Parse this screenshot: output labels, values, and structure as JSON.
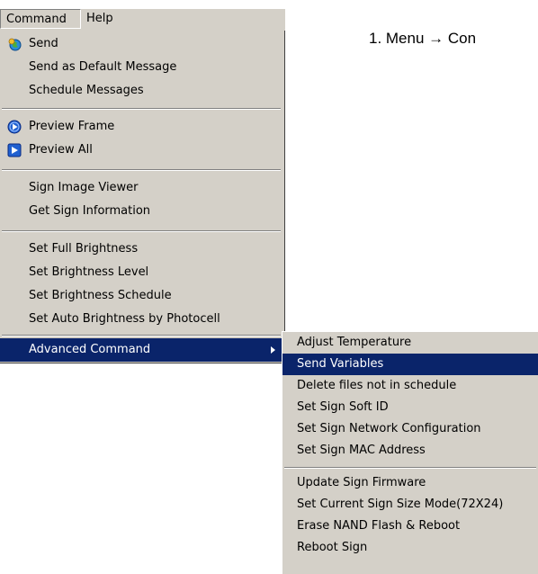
{
  "menubar": {
    "items": [
      {
        "label": "Command"
      },
      {
        "label": "Help"
      }
    ]
  },
  "command_menu": {
    "items": [
      {
        "label": "Send",
        "icon": "send-globe-icon"
      },
      {
        "label": "Send as Default Message"
      },
      {
        "label": "Schedule Messages"
      },
      {
        "label": "Preview Frame",
        "icon": "preview-frame-icon"
      },
      {
        "label": "Preview All",
        "icon": "preview-all-icon"
      },
      {
        "label": "Sign Image Viewer"
      },
      {
        "label": "Get Sign Information"
      },
      {
        "label": "Set Full Brightness"
      },
      {
        "label": "Set Brightness Level"
      },
      {
        "label": "Set Brightness Schedule"
      },
      {
        "label": "Set Auto Brightness by Photocell"
      },
      {
        "label": "Advanced Command",
        "highlighted": true
      }
    ]
  },
  "advanced_submenu": {
    "items": [
      {
        "label": "Adjust Temperature"
      },
      {
        "label": "Send Variables",
        "highlighted": true
      },
      {
        "label": "Delete files not in schedule"
      },
      {
        "label": "Set Sign Soft ID"
      },
      {
        "label": "Set Sign Network Configuration"
      },
      {
        "label": "Set Sign MAC Address"
      },
      {
        "label": "Update Sign Firmware"
      },
      {
        "label": "Set Current Sign Size  Mode(72X24)"
      },
      {
        "label": "Erase NAND Flash &  Reboot"
      },
      {
        "label": "Reboot Sign"
      }
    ]
  },
  "instruction": {
    "text": "1.  Menu → Con"
  },
  "colors": {
    "menu_bg": "#d4d0c8",
    "highlight": "#0a246a",
    "highlight_text": "#ffffff"
  }
}
